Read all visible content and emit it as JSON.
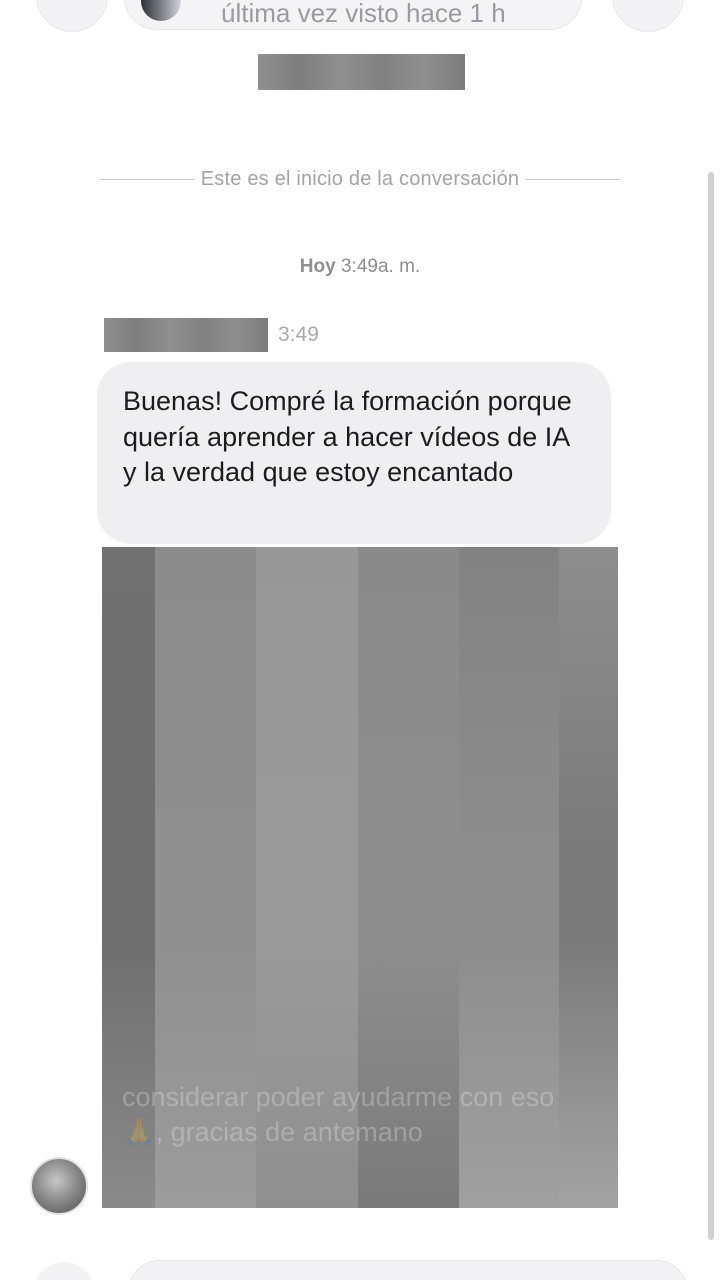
{
  "header": {
    "status_text": "última vez visto hace 1 h"
  },
  "conversation": {
    "start_label": "Este es el inicio de la conversación",
    "day_label": "Hoy",
    "day_time": "3:49",
    "day_suffix": "a. m."
  },
  "message": {
    "time": "3:49",
    "text": "Buenas! Compré la formación porque quería aprender a hacer vídeos de IA y la verdad que estoy encantado",
    "partial_text": "considerar poder ayudarme con eso 🙏, gracias de antemano"
  },
  "media": {
    "columns": [
      {
        "width": 53,
        "top": "#717171",
        "mid": "#6f6f6f",
        "bottom": "#8a8a8a"
      },
      {
        "width": 101,
        "top": "#8c8c8c",
        "mid": "#8f8f8f",
        "bottom": "#9c9c9c"
      },
      {
        "width": 102,
        "top": "#979797",
        "mid": "#9a9a9a",
        "bottom": "#8f8f8f"
      },
      {
        "width": 101,
        "top": "#8a8a8a",
        "mid": "#8e8e8e",
        "bottom": "#7a7a7a"
      },
      {
        "width": 100,
        "top": "#828282",
        "mid": "#8d8d8d",
        "bottom": "#a0a0a0"
      },
      {
        "width": 59,
        "top": "#8e8e8e",
        "mid": "#7b7b7b",
        "bottom": "#a3a3a3"
      }
    ]
  },
  "colors": {
    "bubble": "#efeff1",
    "meta_text": "#a3a3a8",
    "message_text": "#1c1c1e"
  }
}
